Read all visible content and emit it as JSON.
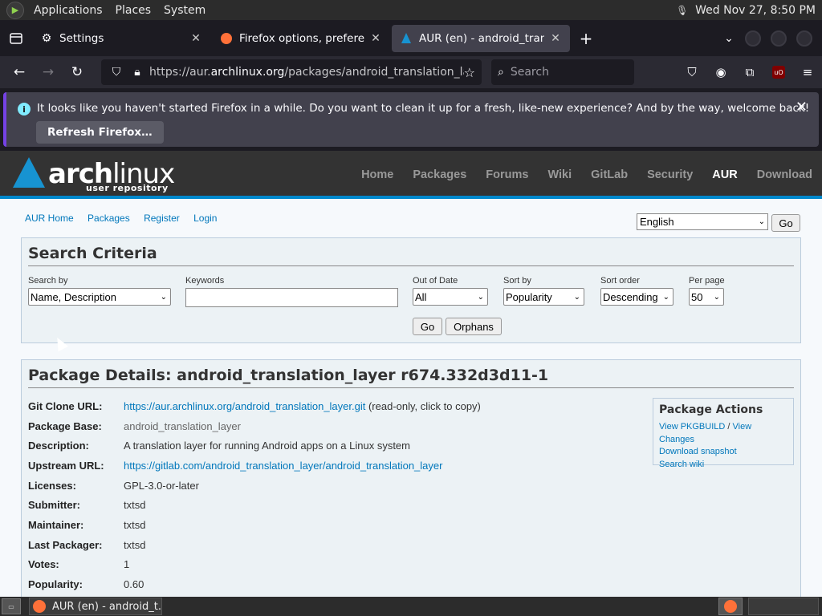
{
  "top_panel": {
    "menus": [
      "Applications",
      "Places",
      "System"
    ],
    "clock": "Wed Nov 27,  8:50 PM"
  },
  "tabs": [
    {
      "label": "Settings",
      "icon": "gear-icon"
    },
    {
      "label": "Firefox options, preferences",
      "icon": "firefox-icon"
    },
    {
      "label": "AUR (en) - android_translati",
      "icon": "arch-icon",
      "active": true
    }
  ],
  "navbar": {
    "url_prefix": "https://aur.",
    "url_host": "archlinux.org",
    "url_path": "/packages/android_translation_layer",
    "search_placeholder": "Search"
  },
  "notification": {
    "message": "It looks like you haven't started Firefox in a while. Do you want to clean it up for a fresh, like-new experience? And by the way, welcome back!",
    "button": "Refresh Firefox…"
  },
  "arch": {
    "logo_arch": "arch",
    "logo_linux": "linux",
    "logo_sub": "user repository",
    "nav": [
      "Home",
      "Packages",
      "Forums",
      "Wiki",
      "GitLab",
      "Security",
      "AUR",
      "Download"
    ],
    "active_nav": "AUR"
  },
  "aur_links": [
    "AUR Home",
    "Packages",
    "Register",
    "Login"
  ],
  "language": {
    "selected": "English",
    "go": "Go"
  },
  "search": {
    "title": "Search Criteria",
    "search_by_label": "Search by",
    "search_by_value": "Name, Description",
    "keywords_label": "Keywords",
    "keywords_value": "",
    "out_of_date_label": "Out of Date",
    "out_of_date_value": "All",
    "sort_by_label": "Sort by",
    "sort_by_value": "Popularity",
    "sort_order_label": "Sort order",
    "sort_order_value": "Descending",
    "per_page_label": "Per page",
    "per_page_value": "50",
    "go": "Go",
    "orphans": "Orphans"
  },
  "package": {
    "title": "Package Details: android_translation_layer r674.332d3d11-1",
    "rows": [
      {
        "key": "Git Clone URL:",
        "link": "https://aur.archlinux.org/android_translation_layer.git",
        "suffix": " (read-only, click to copy)"
      },
      {
        "key": "Package Base:",
        "value": "android_translation_layer"
      },
      {
        "key": "Description:",
        "value": "A translation layer for running Android apps on a Linux system"
      },
      {
        "key": "Upstream URL:",
        "link": "https://gitlab.com/android_translation_layer/android_translation_layer"
      },
      {
        "key": "Licenses:",
        "value": "GPL-3.0-or-later"
      },
      {
        "key": "Submitter:",
        "value": "txtsd"
      },
      {
        "key": "Maintainer:",
        "value": "txtsd"
      },
      {
        "key": "Last Packager:",
        "value": "txtsd"
      },
      {
        "key": "Votes:",
        "value": "1"
      },
      {
        "key": "Popularity:",
        "value": "0.60"
      }
    ],
    "actions_title": "Package Actions",
    "actions": {
      "view_pkgbuild": "View PKGBUILD",
      "sep": " / ",
      "view_changes": "View Changes",
      "download_snapshot": "Download snapshot",
      "search_wiki": "Search wiki"
    }
  },
  "taskbar": {
    "task_label": "AUR (en) - android_t..."
  }
}
